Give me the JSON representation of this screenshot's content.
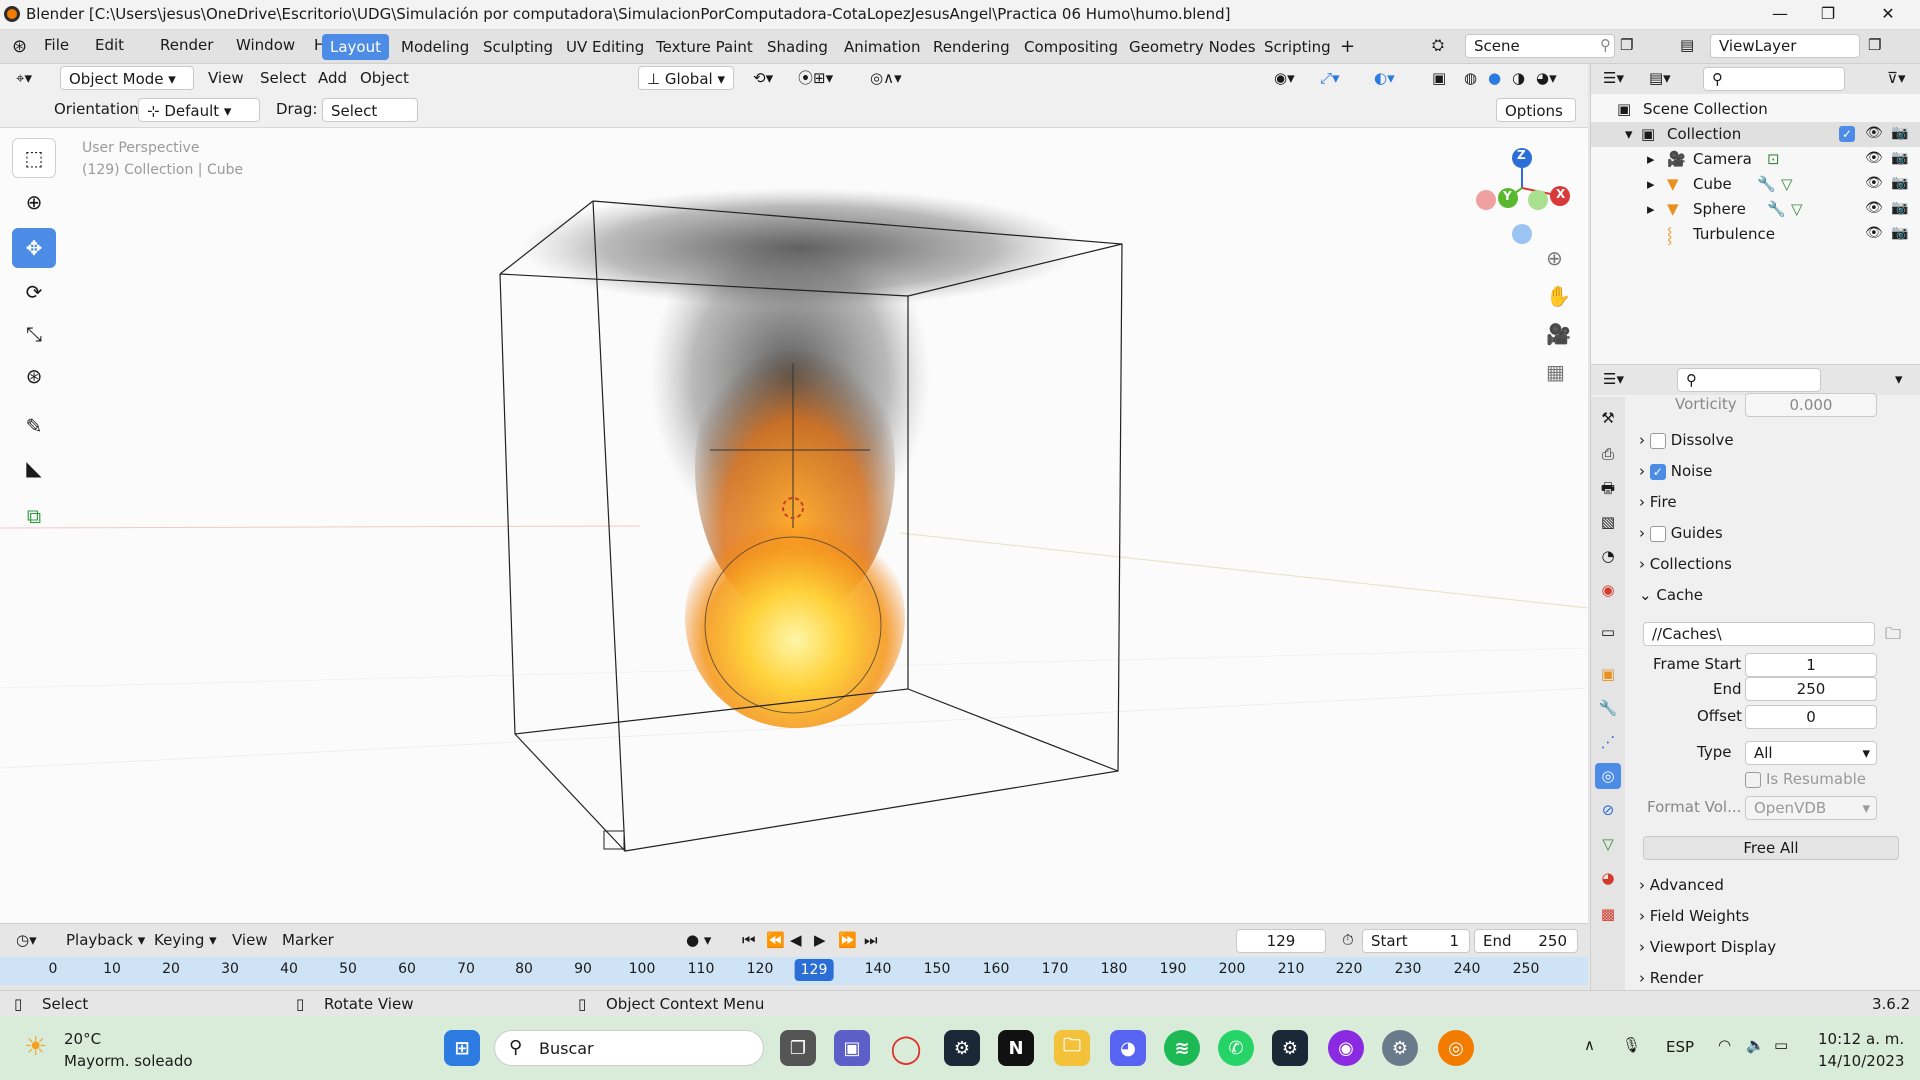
{
  "window": {
    "title": "Blender [C:\\Users\\jesus\\OneDrive\\Escritorio\\UDG\\Simulación por computadora\\SimulacionPorComputadora-CotaLopezJesusAngel\\Practica 06 Humo\\humo.blend]"
  },
  "menu": {
    "items": [
      "File",
      "Edit",
      "Render",
      "Window",
      "Help"
    ]
  },
  "workspaces": [
    "Layout",
    "Modeling",
    "Sculpting",
    "UV Editing",
    "Texture Paint",
    "Shading",
    "Animation",
    "Rendering",
    "Compositing",
    "Geometry Nodes",
    "Scripting"
  ],
  "scene": {
    "name": "Scene",
    "view_layer": "ViewLayer"
  },
  "viewport": {
    "mode": "Object Mode",
    "menus": [
      "View",
      "Select",
      "Add",
      "Object"
    ],
    "transform": "Global",
    "orientation_label": "Orientation:",
    "orientation_value": "Default",
    "drag_label": "Drag:",
    "drag_value": "Select Box",
    "options_label": "Options",
    "info_line1": "User Perspective",
    "info_line2": "(129) Collection | Cube",
    "gizmo": {
      "z": "Z",
      "y": "Y",
      "x": "X"
    }
  },
  "outliner": {
    "root": "Scene Collection",
    "collection": "Collection",
    "items": [
      "Camera",
      "Cube",
      "Sphere",
      "Turbulence"
    ]
  },
  "properties": {
    "vorticity_label": "Vorticity",
    "vorticity_value": "0.000",
    "dissolve": "Dissolve",
    "noise": "Noise",
    "fire": "Fire",
    "guides": "Guides",
    "collections": "Collections",
    "cache": "Cache",
    "cache_path": "//Caches\\",
    "frame_start_label": "Frame Start",
    "frame_start": "1",
    "end_label": "End",
    "end": "250",
    "offset_label": "Offset",
    "offset": "0",
    "type_label": "Type",
    "type_value": "All",
    "is_resumable": "Is Resumable",
    "format_label": "Format Vol...",
    "format_value": "OpenVDB",
    "free_all": "Free All",
    "advanced": "Advanced",
    "field_weights": "Field Weights",
    "viewport_display": "Viewport Display",
    "render": "Render"
  },
  "timeline": {
    "menus": [
      "Playback",
      "Keying",
      "View",
      "Marker"
    ],
    "current_frame": "129",
    "start_label": "Start",
    "start": "1",
    "end_label": "End",
    "end": "250",
    "ticks": [
      "0",
      "10",
      "20",
      "30",
      "40",
      "50",
      "60",
      "70",
      "80",
      "90",
      "100",
      "110",
      "120",
      "129",
      "140",
      "150",
      "160",
      "170",
      "180",
      "190",
      "200",
      "210",
      "220",
      "230",
      "240",
      "250"
    ]
  },
  "status": {
    "select": "Select",
    "rotate": "Rotate View",
    "context": "Object Context Menu",
    "version": "3.6.2"
  },
  "taskbar": {
    "temp": "20°C",
    "weather": "Mayorm. soleado",
    "search": "Buscar",
    "lang": "ESP",
    "time": "10:12 a. m.",
    "date": "14/10/2023"
  }
}
